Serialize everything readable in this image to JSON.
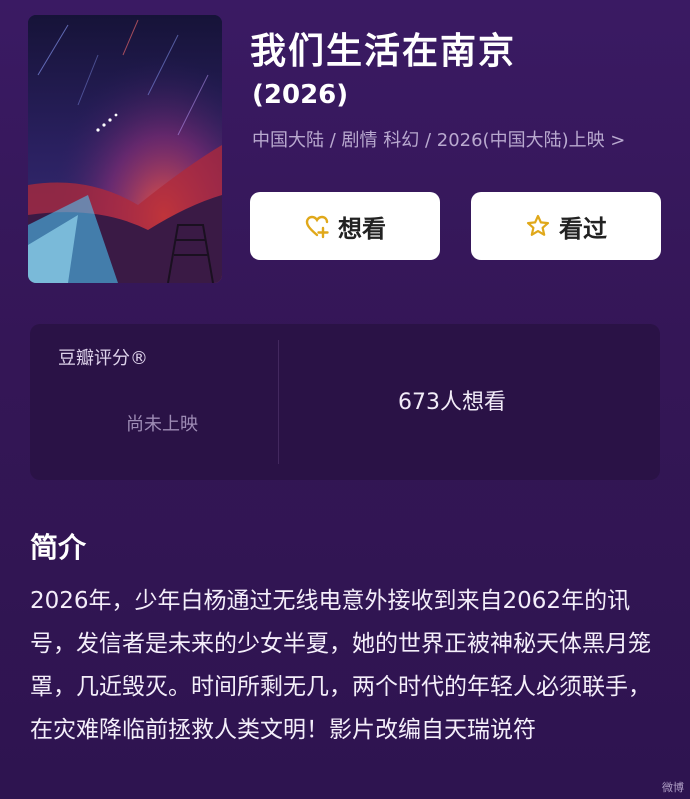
{
  "movie": {
    "title": "我们生活在南京",
    "year": "(2026)",
    "meta": "中国大陆 / 剧情 科幻 / 2026(中国大陆)上映 >"
  },
  "actions": {
    "want_label": "想看",
    "seen_label": "看过"
  },
  "rating": {
    "label": "豆瓣评分®",
    "status": "尚未上映",
    "want_count": "673人想看"
  },
  "intro": {
    "heading": "简介",
    "text": "2026年，少年白杨通过无线电意外接收到来自2062年的讯号，发信者是未来的少女半夏，她的世界正被神秘天体黑月笼罩，几近毁灭。时间所剩无几，两个时代的年轻人必须联手，在灾难降临前拯救人类文明！影片改编自天瑞说符"
  },
  "watermark": "微博",
  "colors": {
    "background": "#341656",
    "card": "#2a1246",
    "icon_accent": "#e0a81a"
  }
}
